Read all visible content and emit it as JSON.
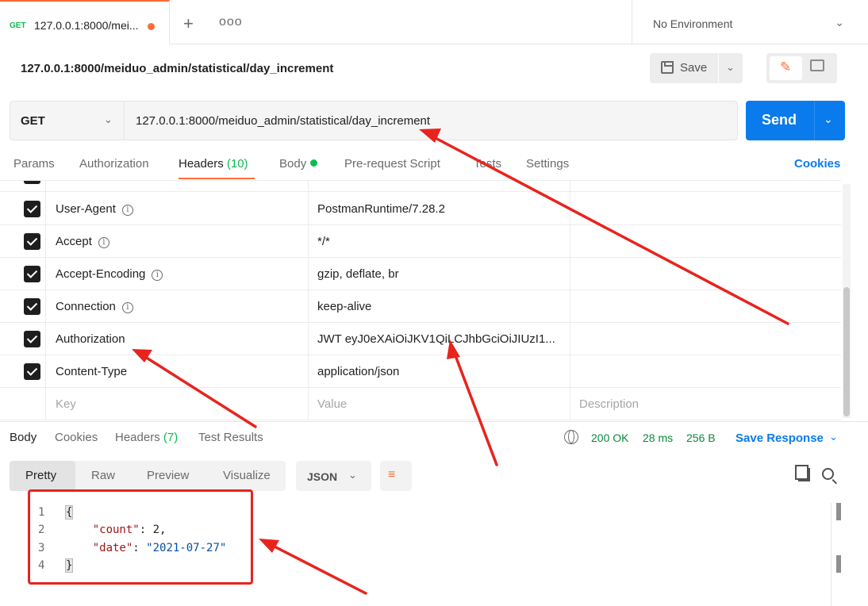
{
  "tab": {
    "method": "GET",
    "title": "127.0.0.1:8000/mei...",
    "new_tab_icon": "plus-icon",
    "more_icon": "ellipsis-icon"
  },
  "environment": {
    "label": "No Environment"
  },
  "request_title": "127.0.0.1:8000/meiduo_admin/statistical/day_increment",
  "toolbar": {
    "save_label": "Save"
  },
  "request": {
    "method": "GET",
    "url": "127.0.0.1:8000/meiduo_admin/statistical/day_increment",
    "send_label": "Send"
  },
  "request_tabs": {
    "params": "Params",
    "authorization": "Authorization",
    "headers": "Headers",
    "headers_count": "(10)",
    "body": "Body",
    "pre_request": "Pre-request Script",
    "tests": "Tests",
    "settings": "Settings",
    "cookies": "Cookies"
  },
  "headers": [
    {
      "key": "User-Agent",
      "value": "PostmanRuntime/7.28.2",
      "info": true,
      "checked": true
    },
    {
      "key": "Accept",
      "value": "*/*",
      "info": true,
      "checked": true
    },
    {
      "key": "Accept-Encoding",
      "value": "gzip, deflate, br",
      "info": true,
      "checked": true
    },
    {
      "key": "Connection",
      "value": "keep-alive",
      "info": true,
      "checked": true
    },
    {
      "key": "Authorization",
      "value": "JWT eyJ0eXAiOiJKV1QiLCJhbGciOiJIUzI1...",
      "info": false,
      "checked": true
    },
    {
      "key": "Content-Type",
      "value": "application/json",
      "info": false,
      "checked": true
    }
  ],
  "headers_placeholder": {
    "key": "Key",
    "value": "Value",
    "description": "Description"
  },
  "response_tabs": {
    "body": "Body",
    "cookies": "Cookies",
    "headers": "Headers",
    "headers_count": "(7)",
    "test_results": "Test Results"
  },
  "response_status": {
    "status": "200 OK",
    "time": "28 ms",
    "size": "256 B",
    "save_response": "Save Response"
  },
  "format_tabs": {
    "pretty": "Pretty",
    "raw": "Raw",
    "preview": "Preview",
    "visualize": "Visualize",
    "language": "JSON"
  },
  "response_body": {
    "lines": [
      "1",
      "2",
      "3",
      "4"
    ],
    "open": "{",
    "count_key": "\"count\"",
    "count_value": "2",
    "date_key": "\"date\"",
    "date_value": "\"2021-07-27\"",
    "close": "}"
  },
  "colors": {
    "accent": "#ff6c37",
    "primary": "#097bed",
    "success": "#0cbb52",
    "annotation": "#e8231e"
  }
}
